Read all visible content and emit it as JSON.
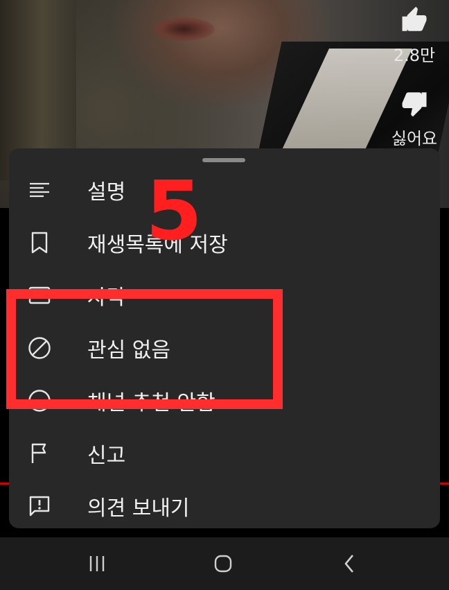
{
  "video": {
    "like_count": "2.8만",
    "dislike_label": "싫어요"
  },
  "sheet": {
    "items": [
      {
        "label": "설명",
        "icon": "description-lines-icon"
      },
      {
        "label": "재생목록에 저장",
        "icon": "bookmark-icon"
      },
      {
        "label": "자막",
        "icon": "captions-icon"
      },
      {
        "label": "관심 없음",
        "icon": "not-interested-icon"
      },
      {
        "label": "채널 추천 안함",
        "icon": "block-channel-icon"
      },
      {
        "label": "신고",
        "icon": "flag-icon"
      },
      {
        "label": "의견 보내기",
        "icon": "feedback-icon"
      }
    ]
  },
  "annotation": {
    "step_number": "5",
    "color": "#ff2e2e"
  },
  "navbar": {
    "buttons": [
      "recent-apps-icon",
      "home-icon",
      "back-icon"
    ]
  }
}
